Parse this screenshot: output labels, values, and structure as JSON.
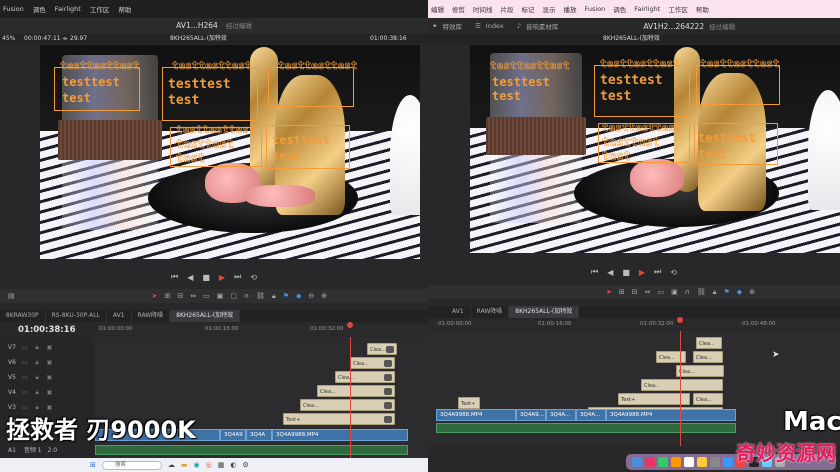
{
  "left": {
    "menu": [
      "Fusion",
      "调色",
      "Fairlight",
      "工作区",
      "帮助"
    ],
    "title": "AV1...H264",
    "title_status": "经过编辑",
    "zoom": "45%",
    "timecode_top": "00:00:47:11",
    "fps": "29.97",
    "clip_name": "8KH265ALL-(加特效",
    "timecode_right": "01:00:38:16",
    "tabs": [
      "8KRAW30P",
      "RS-8KU-30P-ALL",
      "AV1",
      "RAW降噪",
      "8KH265ALL-(加特效"
    ],
    "timecode": "01:00:38:16",
    "ruler": [
      "01:00:00:00",
      "01:00:16:00",
      "01:00:32:00"
    ],
    "tracks": [
      "V7",
      "V6",
      "V5",
      "V4",
      "V3",
      "V2",
      "V1",
      "A1"
    ],
    "track_a1_label": "音频 1",
    "track_a1_level": "2.0",
    "vclips": [
      "3Q4A9",
      "3Q4A",
      "3Q4A9988.MP4"
    ],
    "caption": "拯救者 刃9000K",
    "search_placeholder": "搜索",
    "overlay": {
      "line1": "testtesttest",
      "line2": "testtest",
      "line3": "test"
    }
  },
  "right": {
    "menu": [
      "编辑",
      "修剪",
      "时间线",
      "片段",
      "标记",
      "显示",
      "播放",
      "Fusion",
      "调色",
      "Fairlight",
      "工作区",
      "帮助"
    ],
    "toolbar": [
      "特效库",
      "Index",
      "音响素材库"
    ],
    "title": "AV1H2...264222",
    "title_status": "经过编辑",
    "clip_name": "8KH265ALL-(加特效",
    "tabs": [
      "AV1",
      "RAW降噪",
      "8KH265ALL-(加特效"
    ],
    "ruler": [
      "01:00:00:00",
      "01:00:16:00",
      "01:00:32:00",
      "01:00:48:00"
    ],
    "vclips": [
      "3Q4A9988.MP4",
      "3Q4A9...",
      "3Q4A...",
      "3Q4A...",
      "3Q4A9988.MP4"
    ],
    "caption": "Mac",
    "watermark": "奇妙资源网",
    "overlay": {
      "line1": "testtesttest",
      "line2": "testtest",
      "line3": "test"
    }
  },
  "clip_label_short": "Clea...",
  "clip_label_text": "Text+",
  "colors": {
    "accent": "#e2483a",
    "overlay": "#f39c3a",
    "video": "#3f73a8",
    "audio": "#2f6b3f"
  }
}
